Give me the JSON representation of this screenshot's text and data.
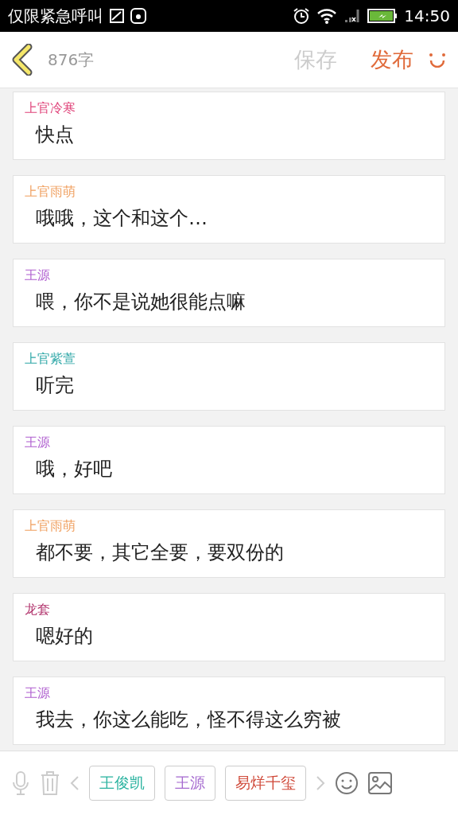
{
  "status_bar": {
    "carrier": "仅限紧急呼叫",
    "time": "14:50"
  },
  "header": {
    "word_count": "876字",
    "save": "保存",
    "publish": "发布"
  },
  "messages": [
    {
      "speaker": "上官冷寒",
      "color": "#e0457b",
      "text": "快点"
    },
    {
      "speaker": "上官雨萌",
      "color": "#f0a060",
      "text": "哦哦，这个和这个…"
    },
    {
      "speaker": "王源",
      "color": "#b060d0",
      "text": "喂，你不是说她很能点嘛"
    },
    {
      "speaker": "上官紫萱",
      "color": "#30a8a8",
      "text": "听完"
    },
    {
      "speaker": "王源",
      "color": "#b060d0",
      "text": "哦，好吧"
    },
    {
      "speaker": "上官雨萌",
      "color": "#f0a060",
      "text": "都不要，其它全要，要双份的"
    },
    {
      "speaker": "龙套",
      "color": "#b0306a",
      "text": "嗯好的"
    },
    {
      "speaker": "王源",
      "color": "#b060d0",
      "text": "我去，你这么能吃，怪不得这么穷被"
    }
  ],
  "toolbar": {
    "characters": [
      {
        "name": "王俊凯",
        "color": "#2bb3a0"
      },
      {
        "name": "王源",
        "color": "#a66bd0"
      },
      {
        "name": "易烊千玺",
        "color": "#d04a3a"
      }
    ]
  }
}
